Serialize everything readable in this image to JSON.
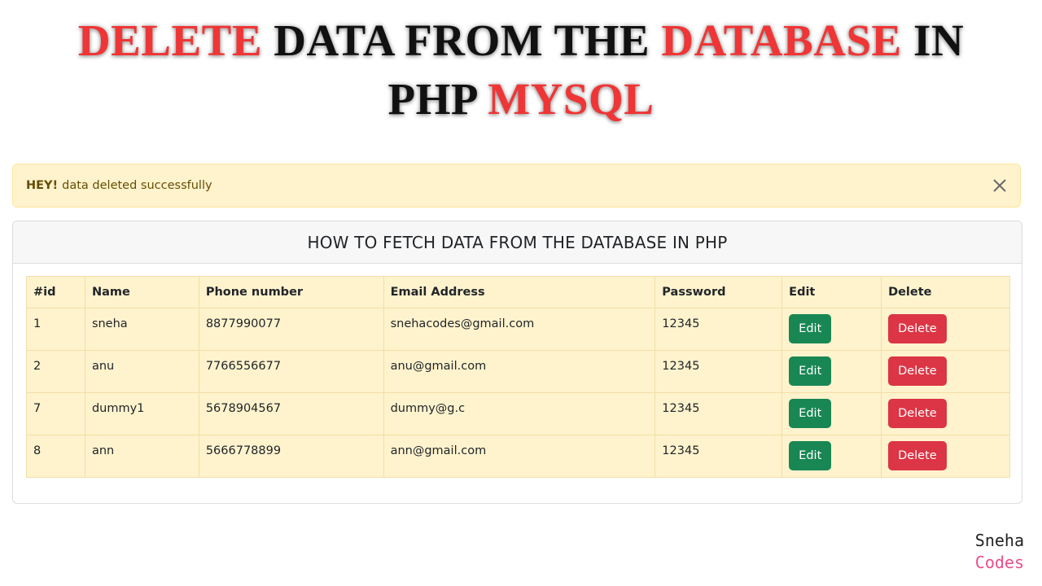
{
  "banner": {
    "line1": [
      {
        "text": "DELETE ",
        "color": "red"
      },
      {
        "text": " DATA FROM THE ",
        "color": "black"
      },
      {
        "text": "DATABASE",
        "color": "red"
      },
      {
        "text": " IN",
        "color": "black"
      }
    ],
    "line2": [
      {
        "text": "PHP ",
        "color": "black"
      },
      {
        "text": "MYSQL",
        "color": "red"
      }
    ]
  },
  "alert": {
    "strong": "HEY!",
    "message": "data deleted successfully",
    "close_icon": "close-icon"
  },
  "card": {
    "title": "HOW TO FETCH DATA FROM THE DATABASE IN PHP"
  },
  "table": {
    "headers": [
      "#id",
      "Name",
      "Phone number",
      "Email Address",
      "Password",
      "Edit",
      "Delete"
    ],
    "rows": [
      {
        "id": "1",
        "name": "sneha",
        "phone": "8877990077",
        "email": "snehacodes@gmail.com",
        "password": "12345",
        "edit": "Edit",
        "delete": "Delete"
      },
      {
        "id": "2",
        "name": "anu",
        "phone": "7766556677",
        "email": "anu@gmail.com",
        "password": "12345",
        "edit": "Edit",
        "delete": "Delete"
      },
      {
        "id": "7",
        "name": "dummy1",
        "phone": "5678904567",
        "email": "dummy@g.c",
        "password": "12345",
        "edit": "Edit",
        "delete": "Delete"
      },
      {
        "id": "8",
        "name": "ann",
        "phone": "5666778899",
        "email": "ann@gmail.com",
        "password": "12345",
        "edit": "Edit",
        "delete": "Delete"
      }
    ]
  },
  "watermark": {
    "line1": "Sneha",
    "line2": "Codes"
  },
  "colors": {
    "banner_red": "#ef3535",
    "alert_bg": "#fff3cd",
    "alert_text": "#664d03",
    "edit_button": "#198754",
    "delete_button": "#dc3545",
    "watermark_pink": "#e94e8a"
  }
}
